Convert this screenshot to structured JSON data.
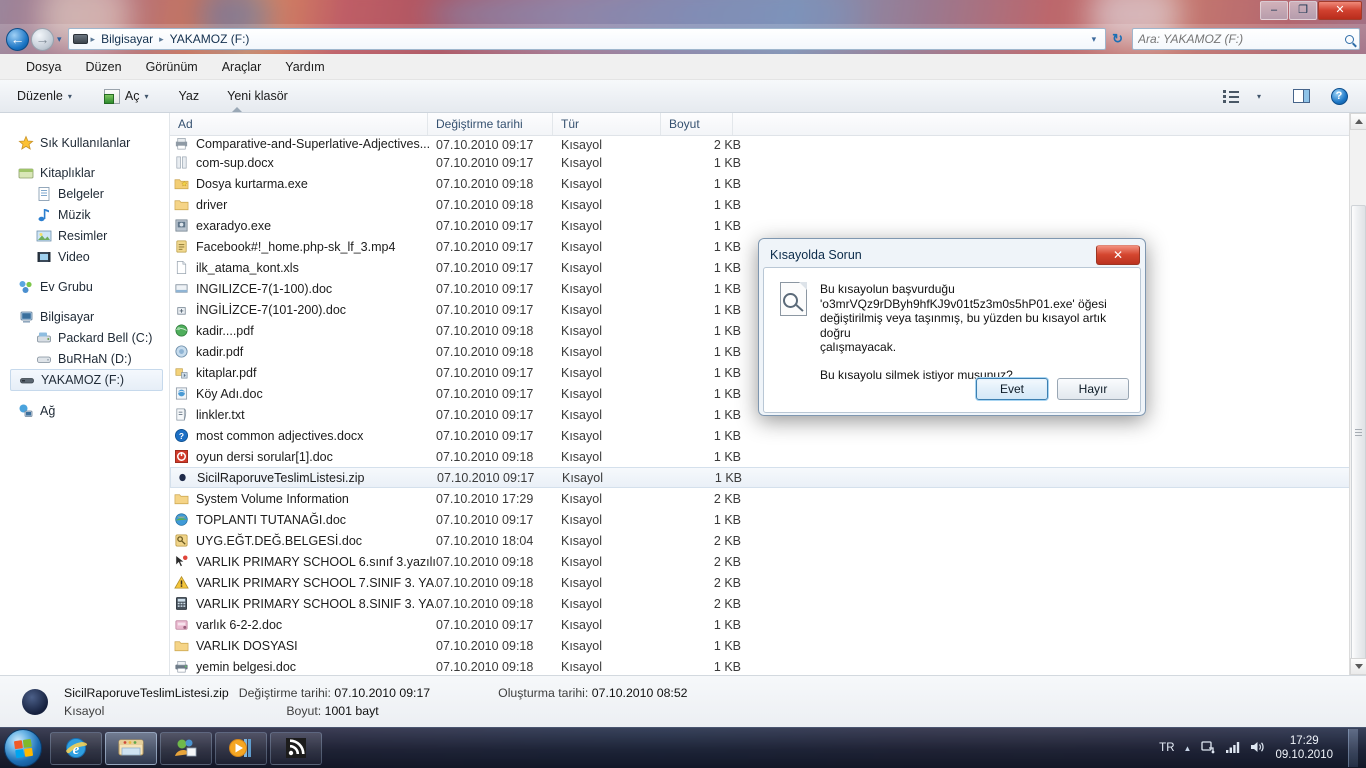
{
  "window": {
    "minimize_label": "–",
    "maximize_label": "❐",
    "close_label": "✕"
  },
  "nav": {
    "back_glyph": "←",
    "forward_glyph": "→",
    "history_caret": "▾",
    "refresh_glyph": "↻",
    "breadcrumb": [
      "Bilgisayar",
      "YAKAMOZ (F:)"
    ],
    "crumb_sep": "▸"
  },
  "search": {
    "placeholder": "Ara: YAKAMOZ (F:)",
    "value": ""
  },
  "menubar": [
    "Dosya",
    "Düzen",
    "Görünüm",
    "Araçlar",
    "Yardım"
  ],
  "toolbar": {
    "organize": "Düzenle",
    "open": "Aç",
    "burn": "Yaz",
    "new_folder": "Yeni klasör",
    "caret": "▾",
    "help": "?"
  },
  "sidebar": {
    "items": [
      {
        "label": "Sık Kullanılanlar",
        "icon": "star-icon",
        "level": "group"
      },
      {
        "label": "Kitaplıklar",
        "icon": "library-icon",
        "level": "group"
      },
      {
        "label": "Belgeler",
        "icon": "documents-icon",
        "level": "child"
      },
      {
        "label": "Müzik",
        "icon": "music-icon",
        "level": "child"
      },
      {
        "label": "Resimler",
        "icon": "pictures-icon",
        "level": "child"
      },
      {
        "label": "Video",
        "icon": "video-icon",
        "level": "child"
      },
      {
        "label": "Ev Grubu",
        "icon": "homegroup-icon",
        "level": "group"
      },
      {
        "label": "Bilgisayar",
        "icon": "computer-icon",
        "level": "group"
      },
      {
        "label": "Packard Bell (C:)",
        "icon": "harddisk-icon",
        "level": "child"
      },
      {
        "label": "BuRHaN (D:)",
        "icon": "drive-icon",
        "level": "child"
      },
      {
        "label": "YAKAMOZ (F:)",
        "icon": "usb-drive-icon",
        "level": "child",
        "selected": true
      },
      {
        "label": "Ağ",
        "icon": "network-icon",
        "level": "group"
      }
    ]
  },
  "filelist": {
    "columns": [
      "Ad",
      "Değiştirme tarihi",
      "Tür",
      "Boyut"
    ],
    "sort_column": "Ad",
    "sort_direction": "ascending",
    "rows": [
      {
        "name": "Comparative-and-Superlative-Adjectives...",
        "date": "07.10.2010 09:17",
        "type": "Kısayol",
        "size": "2 KB",
        "icon": "printer-icon",
        "partial": true
      },
      {
        "name": "com-sup.docx",
        "date": "07.10.2010 09:17",
        "type": "Kısayol",
        "size": "1 KB",
        "icon": "generic-doc-icon"
      },
      {
        "name": "Dosya kurtarma.exe",
        "date": "07.10.2010 09:18",
        "type": "Kısayol",
        "size": "1 KB",
        "icon": "folder-star-icon"
      },
      {
        "name": "driver",
        "date": "07.10.2010 09:18",
        "type": "Kısayol",
        "size": "1 KB",
        "icon": "folder-icon"
      },
      {
        "name": "exaradyo.exe",
        "date": "07.10.2010 09:17",
        "type": "Kısayol",
        "size": "1 KB",
        "icon": "app-icon"
      },
      {
        "name": "Facebook#!_home.php-sk_lf_3.mp4",
        "date": "07.10.2010 09:17",
        "type": "Kısayol",
        "size": "1 KB",
        "icon": "note-icon"
      },
      {
        "name": "ilk_atama_kont.xls",
        "date": "07.10.2010 09:17",
        "type": "Kısayol",
        "size": "1 KB",
        "icon": "blank-page-icon"
      },
      {
        "name": "INGILIZCE-7(1-100).doc",
        "date": "07.10.2010 09:17",
        "type": "Kısayol",
        "size": "1 KB",
        "icon": "window-icon"
      },
      {
        "name": "İNGİLİZCE-7(101-200).doc",
        "date": "07.10.2010 09:17",
        "type": "Kısayol",
        "size": "1 KB",
        "icon": "small-box-icon"
      },
      {
        "name": "kadir....pdf",
        "date": "07.10.2010 09:18",
        "type": "Kısayol",
        "size": "1 KB",
        "icon": "globe-icon"
      },
      {
        "name": "kadir.pdf",
        "date": "07.10.2010 09:18",
        "type": "Kısayol",
        "size": "1 KB",
        "icon": "circle-icon"
      },
      {
        "name": "kitaplar.pdf",
        "date": "07.10.2010 09:17",
        "type": "Kısayol",
        "size": "1 KB",
        "icon": "install-icon"
      },
      {
        "name": "Köy Adı.doc",
        "date": "07.10.2010 09:17",
        "type": "Kısayol",
        "size": "1 KB",
        "icon": "web-doc-icon"
      },
      {
        "name": "linkler.txt",
        "date": "07.10.2010 09:17",
        "type": "Kısayol",
        "size": "1 KB",
        "icon": "script-icon"
      },
      {
        "name": "most common adjectives.docx",
        "date": "07.10.2010 09:17",
        "type": "Kısayol",
        "size": "1 KB",
        "icon": "help-blue-icon"
      },
      {
        "name": "oyun dersi sorular[1].doc",
        "date": "07.10.2010 09:18",
        "type": "Kısayol",
        "size": "1 KB",
        "icon": "stop-red-icon"
      },
      {
        "name": "SicilRaporuveTeslimListesi.zip",
        "date": "07.10.2010 09:17",
        "type": "Kısayol",
        "size": "1 KB",
        "icon": "dot-dark-icon",
        "selected": true
      },
      {
        "name": "System Volume Information",
        "date": "07.10.2010 17:29",
        "type": "Kısayol",
        "size": "2 KB",
        "icon": "folder-icon"
      },
      {
        "name": "TOPLANTI TUTANAĞI.doc",
        "date": "07.10.2010 09:17",
        "type": "Kısayol",
        "size": "1 KB",
        "icon": "globe-color-icon"
      },
      {
        "name": "UYG.EĞT.DEĞ.BELGESİ.doc",
        "date": "07.10.2010 18:04",
        "type": "Kısayol",
        "size": "2 KB",
        "icon": "key-icon"
      },
      {
        "name": "VARLIK  PRIMARY SCHOOL 6.sınıf 3.yazılı...",
        "date": "07.10.2010 09:18",
        "type": "Kısayol",
        "size": "2 KB",
        "icon": "cursor-icon"
      },
      {
        "name": "VARLIK  PRIMARY SCHOOL 7.SINIF 3. YA...",
        "date": "07.10.2010 09:18",
        "type": "Kısayol",
        "size": "2 KB",
        "icon": "warning-icon"
      },
      {
        "name": "VARLIK  PRIMARY SCHOOL 8.SINIF 3. YA...",
        "date": "07.10.2010 09:18",
        "type": "Kısayol",
        "size": "2 KB",
        "icon": "calculator-icon"
      },
      {
        "name": "varlık 6-2-2.doc",
        "date": "07.10.2010 09:17",
        "type": "Kısayol",
        "size": "1 KB",
        "icon": "pink-app-icon"
      },
      {
        "name": "VARLIK DOSYASI",
        "date": "07.10.2010 09:18",
        "type": "Kısayol",
        "size": "1 KB",
        "icon": "folder-icon"
      },
      {
        "name": "yemin belgesi.doc",
        "date": "07.10.2010 09:18",
        "type": "Kısayol",
        "size": "1 KB",
        "icon": "printer-color-icon"
      }
    ]
  },
  "details": {
    "filename": "SicilRaporuveTeslimListesi.zip",
    "kind": "Kısayol",
    "modified_label": "Değiştirme tarihi:",
    "modified_value": "07.10.2010 09:17",
    "size_label": "Boyut:",
    "size_value": "1001 bayt",
    "created_label": "Oluşturma tarihi:",
    "created_value": "07.10.2010 08:52"
  },
  "dialog": {
    "title": "Kısayolda Sorun",
    "close_label": "✕",
    "message_line1": "Bu kısayolun başvurduğu",
    "message_line2": "'o3mrVQz9rDByh9hfKJ9v01t5z3m0s5hP01.exe' öğesi",
    "message_line3": "değiştirilmiş veya taşınmış, bu yüzden bu kısayol artık doğru",
    "message_line4": "çalışmayacak.",
    "question": "Bu kısayolu silmek istiyor musunuz?",
    "yes_label": "Evet",
    "no_label": "Hayır"
  },
  "taskbar": {
    "apps": [
      {
        "name": "internet-explorer",
        "active": false
      },
      {
        "name": "windows-explorer",
        "active": true
      },
      {
        "name": "messenger",
        "active": false
      },
      {
        "name": "media-player",
        "active": false
      },
      {
        "name": "feed-reader",
        "active": false
      }
    ],
    "tray": {
      "language": "TR",
      "chevron": "▲",
      "time": "17:29",
      "date": "09.10.2010"
    }
  },
  "colors": {
    "accent": "#1a74c4",
    "close_red": "#d0402e",
    "selection": "#eaf0f7",
    "header_text": "#355170"
  }
}
